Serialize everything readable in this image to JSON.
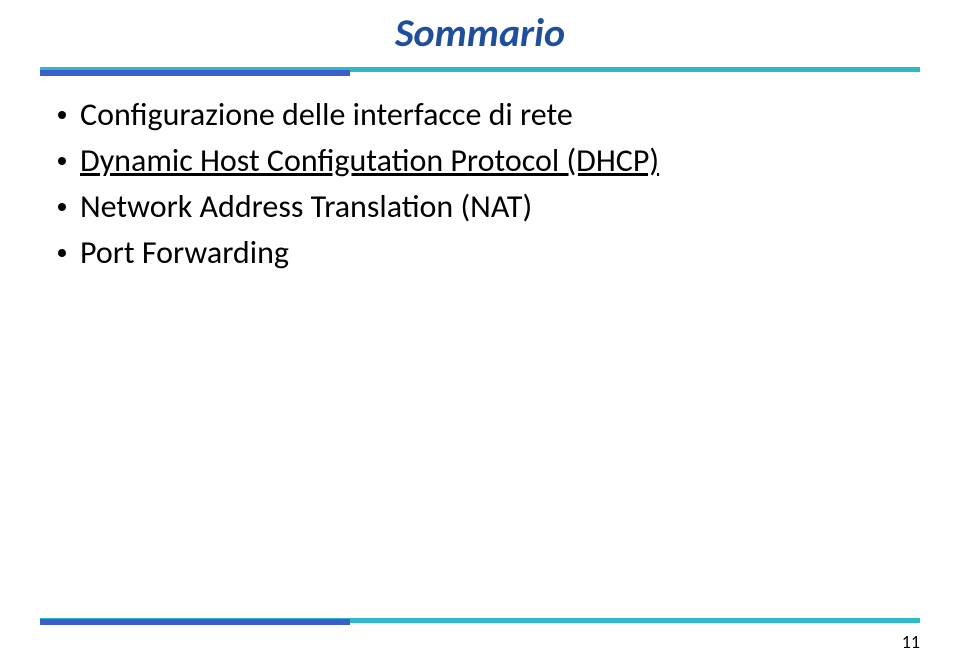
{
  "title": "Sommario",
  "bullets": [
    {
      "text": "Configurazione delle interfacce di rete",
      "underline": false
    },
    {
      "text": "Dynamic Host Configutation Protocol (DHCP)",
      "underline": true
    },
    {
      "text": "Network Address Translation (NAT)",
      "underline": false
    },
    {
      "text": "Port Forwarding",
      "underline": false
    }
  ],
  "page_number": "11"
}
